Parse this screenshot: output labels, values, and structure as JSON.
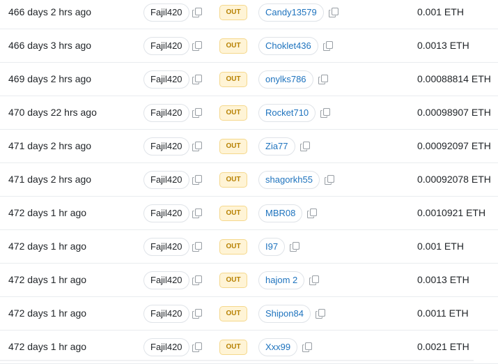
{
  "transactions": [
    {
      "age": "466 days 2 hrs ago",
      "from": "Fajil420",
      "direction": "OUT",
      "to": "Candy13579",
      "amount": "0.001 ETH"
    },
    {
      "age": "466 days 3 hrs ago",
      "from": "Fajil420",
      "direction": "OUT",
      "to": "Choklet436",
      "amount": "0.0013 ETH"
    },
    {
      "age": "469 days 2 hrs ago",
      "from": "Fajil420",
      "direction": "OUT",
      "to": "onylks786",
      "amount": "0.00088814 ETH"
    },
    {
      "age": "470 days 22 hrs ago",
      "from": "Fajil420",
      "direction": "OUT",
      "to": "Rocket710",
      "amount": "0.00098907 ETH"
    },
    {
      "age": "471 days 2 hrs ago",
      "from": "Fajil420",
      "direction": "OUT",
      "to": "Zia77",
      "amount": "0.00092097 ETH"
    },
    {
      "age": "471 days 2 hrs ago",
      "from": "Fajil420",
      "direction": "OUT",
      "to": "shagorkh55",
      "amount": "0.00092078 ETH"
    },
    {
      "age": "472 days 1 hr ago",
      "from": "Fajil420",
      "direction": "OUT",
      "to": "MBR08",
      "amount": "0.0010921 ETH"
    },
    {
      "age": "472 days 1 hr ago",
      "from": "Fajil420",
      "direction": "OUT",
      "to": "I97",
      "amount": "0.001 ETH"
    },
    {
      "age": "472 days 1 hr ago",
      "from": "Fajil420",
      "direction": "OUT",
      "to": "hajom 2",
      "amount": "0.0013 ETH"
    },
    {
      "age": "472 days 1 hr ago",
      "from": "Fajil420",
      "direction": "OUT",
      "to": "Shipon84",
      "amount": "0.0011 ETH"
    },
    {
      "age": "472 days 1 hr ago",
      "from": "Fajil420",
      "direction": "OUT",
      "to": "Xxx99",
      "amount": "0.0021 ETH"
    }
  ],
  "icons": {
    "copy": "copy-icon"
  },
  "colors": {
    "address_link": "#1e73be",
    "out_badge_text": "#b78103",
    "out_badge_bg": "#fff4d6",
    "row_border": "#e9ecef"
  }
}
